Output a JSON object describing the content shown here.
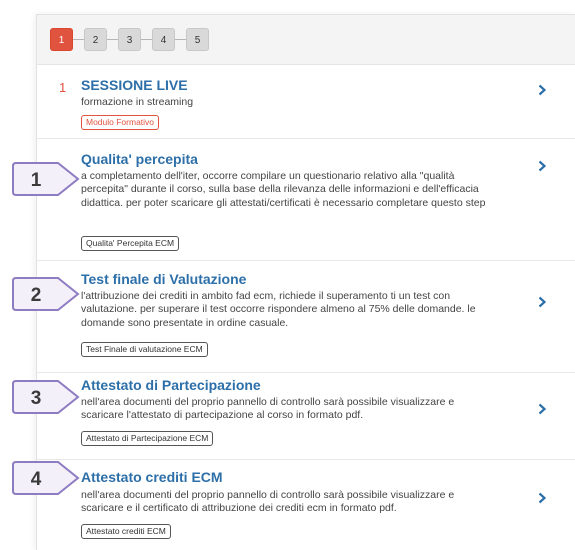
{
  "steps": [
    "1",
    "2",
    "3",
    "4",
    "5"
  ],
  "active_step": "1",
  "items": [
    {
      "number": "1",
      "title": "SESSIONE LIVE",
      "subtitle": "formazione in streaming",
      "tag": "Modulo Formativo"
    },
    {
      "title": "Qualita' percepita",
      "description": "a completamento dell'iter, occorre compilare un questionario relativo alla \"qualità percepita\" durante il corso, sulla base della rilevanza delle informazioni e dell'efficacia didattica. per poter scaricare gli attestati/certificati è necessario completare questo step",
      "tag": "Qualita' Percepita ECM",
      "callout": "1"
    },
    {
      "title": "Test finale di Valutazione",
      "description": "l'attribuzione dei crediti in ambito fad ecm, richiede il superamento ti un test con valutazione. per superare il test occorre rispondere almeno al 75% delle domande. le domande sono presentate in ordine casuale.",
      "tag": "Test Finale di valutazione ECM",
      "callout": "2"
    },
    {
      "title": "Attestato di Partecipazione",
      "description": "nell'area documenti del proprio pannello di controllo sarà possibile visualizzare e scaricare l'attestato di partecipazione al corso in formato pdf.",
      "tag": "Attestato di Partecipazione ECM",
      "callout": "3"
    },
    {
      "title": "Attestato crediti ECM",
      "description": "nell'area documenti del proprio pannello di controllo sarà possibile visualizzare e scaricare e il certificato di attribuzione dei crediti ecm in formato pdf.",
      "tag": "Attestato crediti ECM",
      "callout": "4"
    }
  ],
  "colors": {
    "accent_red": "#e0533f",
    "title_blue": "#2d6fa8",
    "callout_purple": "#8e7cc3"
  },
  "icons": {
    "chevron": "chevron-right-icon"
  }
}
